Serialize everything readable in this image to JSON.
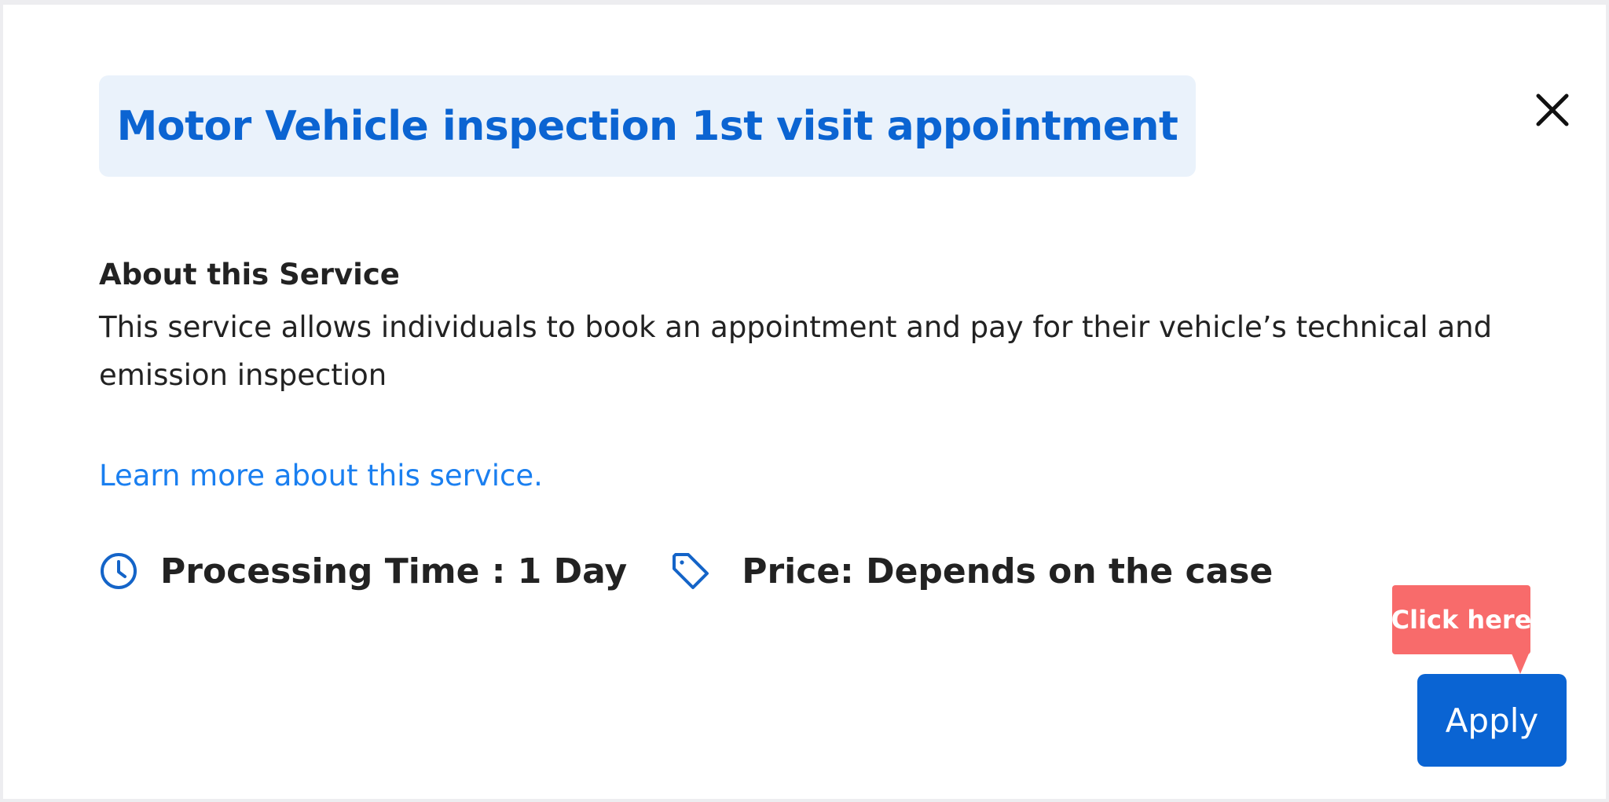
{
  "modal": {
    "title": "Motor Vehicle inspection 1st visit appointment",
    "close_icon": "close-icon"
  },
  "about": {
    "heading": "About this Service",
    "description": "This service allows individuals to book an appointment and pay for their vehicle’s technical and emission inspection",
    "learn_more_link": "Learn more about this service."
  },
  "meta": {
    "processing_icon": "clock-icon",
    "processing_time": "Processing Time : 1 Day",
    "price_icon": "tag-icon",
    "price": "Price: Depends on the case"
  },
  "tooltip": {
    "text": "Click here"
  },
  "actions": {
    "apply_label": "Apply"
  },
  "colors": {
    "title_text": "#0b64d2",
    "title_bg": "#eaf2fb",
    "link": "#1a7ff0",
    "icon": "#1464c8",
    "tooltip_bg": "#f86b6b",
    "primary_button": "#0a64d3",
    "body_text": "#222222"
  }
}
